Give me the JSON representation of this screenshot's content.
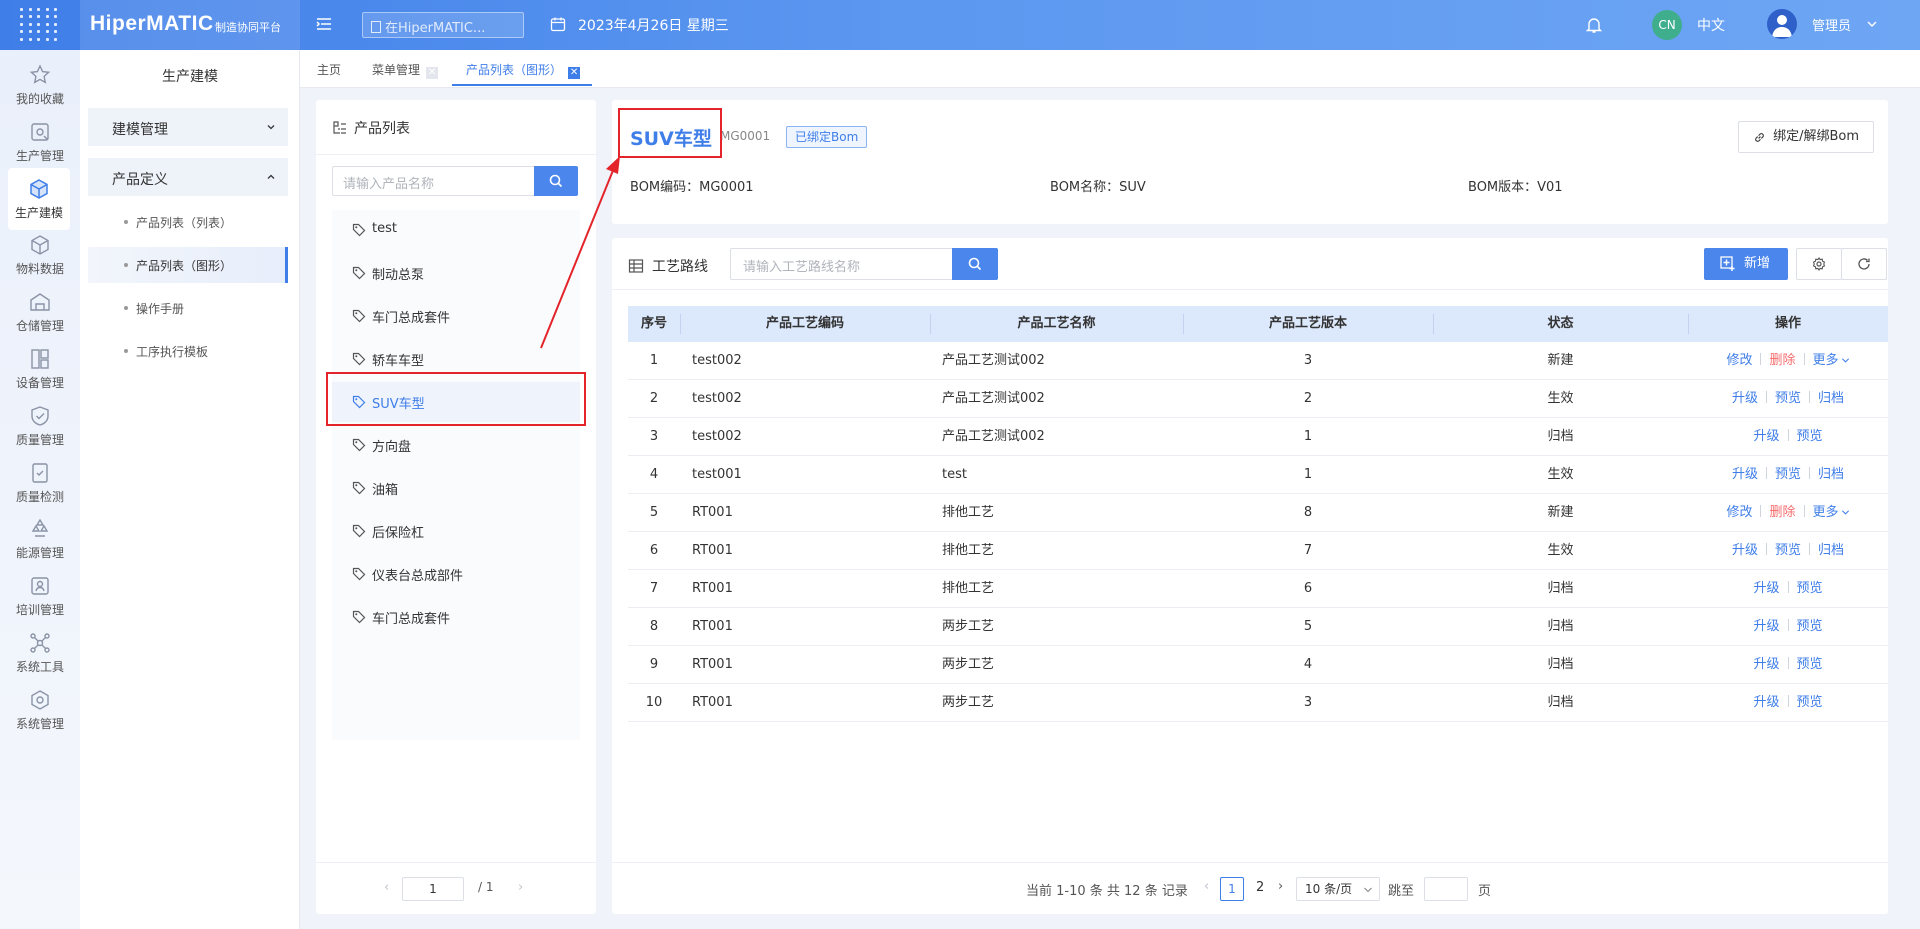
{
  "app": {
    "logo": "HiperMATIC",
    "logo_sub": "制造协同平台",
    "search_placeholder": "在HiperMATIC...",
    "date": "2023年4月26日 星期三",
    "lang_badge": "CN",
    "lang": "中文",
    "user": "管理员",
    "accent_color": "#3f7ee8"
  },
  "leftnav": [
    {
      "label": "我的收藏",
      "icon": "star-icon"
    },
    {
      "label": "生产管理",
      "icon": "production-icon"
    },
    {
      "label": "生产建模",
      "icon": "cube-icon",
      "active": true
    },
    {
      "label": "物料数据",
      "icon": "material-icon"
    },
    {
      "label": "仓储管理",
      "icon": "warehouse-icon"
    },
    {
      "label": "设备管理",
      "icon": "device-icon"
    },
    {
      "label": "质量管理",
      "icon": "quality-icon"
    },
    {
      "label": "质量检测",
      "icon": "inspection-icon"
    },
    {
      "label": "能源管理",
      "icon": "energy-icon"
    },
    {
      "label": "培训管理",
      "icon": "training-icon"
    },
    {
      "label": "系统工具",
      "icon": "tools-icon"
    },
    {
      "label": "系统管理",
      "icon": "system-icon"
    }
  ],
  "sidemenu": {
    "title": "生产建模",
    "groups": [
      {
        "label": "建模管理",
        "expanded": false
      },
      {
        "label": "产品定义",
        "expanded": true
      }
    ],
    "subitems": [
      {
        "label": "产品列表（列表）"
      },
      {
        "label": "产品列表（图形）",
        "active": true
      },
      {
        "label": "操作手册"
      },
      {
        "label": "工序执行模板"
      }
    ]
  },
  "tabs": [
    {
      "label": "主页"
    },
    {
      "label": "菜单管理"
    },
    {
      "label": "产品列表（图形）",
      "active": true
    }
  ],
  "product_list": {
    "title": "产品列表",
    "search_placeholder": "请输入产品名称",
    "items": [
      "test",
      "制动总泵",
      "车门总成套件",
      "轿车车型",
      "SUV车型",
      "方向盘",
      "油箱",
      "后保险杠",
      "仪表台总成部件",
      "车门总成套件"
    ],
    "selected": "SUV车型",
    "page": "1",
    "total_pages": "/ 1"
  },
  "detail": {
    "name": "SUV车型",
    "code": "MG0001",
    "tag": "已绑定Bom",
    "bind_button": "绑定/解绑Bom",
    "bom_code": "BOM编码：MG0001",
    "bom_name": "BOM名称：SUV",
    "bom_version": "BOM版本：V01"
  },
  "route": {
    "title": "工艺路线",
    "search_placeholder": "请输入工艺路线名称",
    "add_button": "新增",
    "columns": [
      "序号",
      "产品工艺编码",
      "产品工艺名称",
      "产品工艺版本",
      "状态",
      "操作"
    ],
    "rows": [
      {
        "no": "1",
        "code": "test002",
        "name": "产品工艺测试002",
        "version": "3",
        "status": "新建",
        "ops": [
          "修改",
          "删除",
          "更多"
        ]
      },
      {
        "no": "2",
        "code": "test002",
        "name": "产品工艺测试002",
        "version": "2",
        "status": "生效",
        "ops": [
          "升级",
          "预览",
          "归档"
        ]
      },
      {
        "no": "3",
        "code": "test002",
        "name": "产品工艺测试002",
        "version": "1",
        "status": "归档",
        "ops": [
          "升级",
          "预览"
        ]
      },
      {
        "no": "4",
        "code": "test001",
        "name": "test",
        "version": "1",
        "status": "生效",
        "ops": [
          "升级",
          "预览",
          "归档"
        ]
      },
      {
        "no": "5",
        "code": "RT001",
        "name": "排他工艺",
        "version": "8",
        "status": "新建",
        "ops": [
          "修改",
          "删除",
          "更多"
        ]
      },
      {
        "no": "6",
        "code": "RT001",
        "name": "排他工艺",
        "version": "7",
        "status": "生效",
        "ops": [
          "升级",
          "预览",
          "归档"
        ]
      },
      {
        "no": "7",
        "code": "RT001",
        "name": "排他工艺",
        "version": "6",
        "status": "归档",
        "ops": [
          "升级",
          "预览"
        ]
      },
      {
        "no": "8",
        "code": "RT001",
        "name": "两步工艺",
        "version": "5",
        "status": "归档",
        "ops": [
          "升级",
          "预览"
        ]
      },
      {
        "no": "9",
        "code": "RT001",
        "name": "两步工艺",
        "version": "4",
        "status": "归档",
        "ops": [
          "升级",
          "预览"
        ]
      },
      {
        "no": "10",
        "code": "RT001",
        "name": "两步工艺",
        "version": "3",
        "status": "归档",
        "ops": [
          "升级",
          "预览"
        ]
      }
    ],
    "pager": {
      "summary": "当前 1-10 条 共 12 条 记录",
      "pages": [
        "1",
        "2"
      ],
      "current": "1",
      "page_size": "10 条/页",
      "jump_label": "跳至",
      "page_label": "页"
    }
  }
}
